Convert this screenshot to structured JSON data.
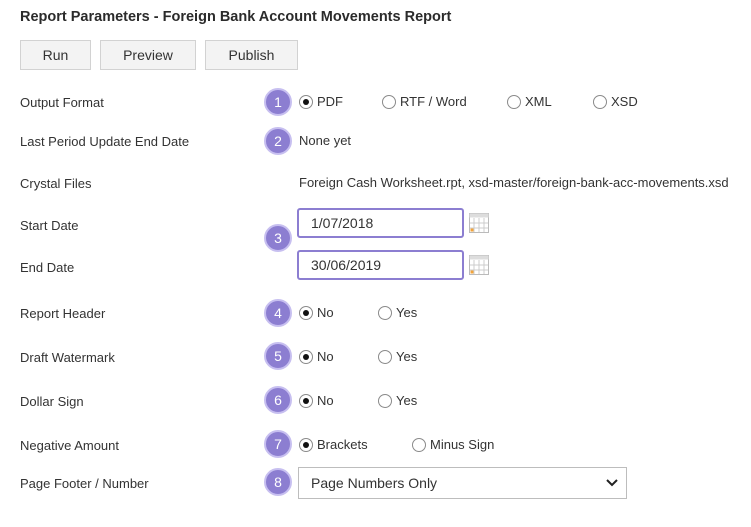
{
  "title": "Report Parameters - Foreign Bank Account Movements Report",
  "toolbar": {
    "run_label": "Run",
    "preview_label": "Preview",
    "publish_label": "Publish"
  },
  "badges": [
    "1",
    "2",
    "3",
    "4",
    "5",
    "6",
    "7",
    "8"
  ],
  "output_format": {
    "label": "Output Format",
    "options": [
      "PDF",
      "RTF / Word",
      "XML",
      "XSD"
    ],
    "selected": "PDF"
  },
  "last_period": {
    "label": "Last Period Update End Date",
    "value": "None yet"
  },
  "crystal_files": {
    "label": "Crystal Files",
    "value": "Foreign Cash Worksheet.rpt, xsd-master/foreign-bank-acc-movements.xsd"
  },
  "start_date": {
    "label": "Start Date",
    "value": "1/07/2018"
  },
  "end_date": {
    "label": "End Date",
    "value": "30/06/2019"
  },
  "report_header": {
    "label": "Report Header",
    "options": [
      "No",
      "Yes"
    ],
    "selected": "No"
  },
  "draft_watermark": {
    "label": "Draft Watermark",
    "options": [
      "No",
      "Yes"
    ],
    "selected": "No"
  },
  "dollar_sign": {
    "label": "Dollar Sign",
    "options": [
      "No",
      "Yes"
    ],
    "selected": "No"
  },
  "negative_amount": {
    "label": "Negative Amount",
    "options": [
      "Brackets",
      "Minus Sign"
    ],
    "selected": "Brackets"
  },
  "page_footer": {
    "label": "Page Footer / Number",
    "value": "Page Numbers Only"
  },
  "colors": {
    "badge": "#8c7ed1",
    "highlight_border": "#8c7ed1",
    "button_bg": "#f3f3f3"
  },
  "icons": {
    "calendar": "calendar-icon",
    "dropdown": "chevron-down-icon"
  }
}
